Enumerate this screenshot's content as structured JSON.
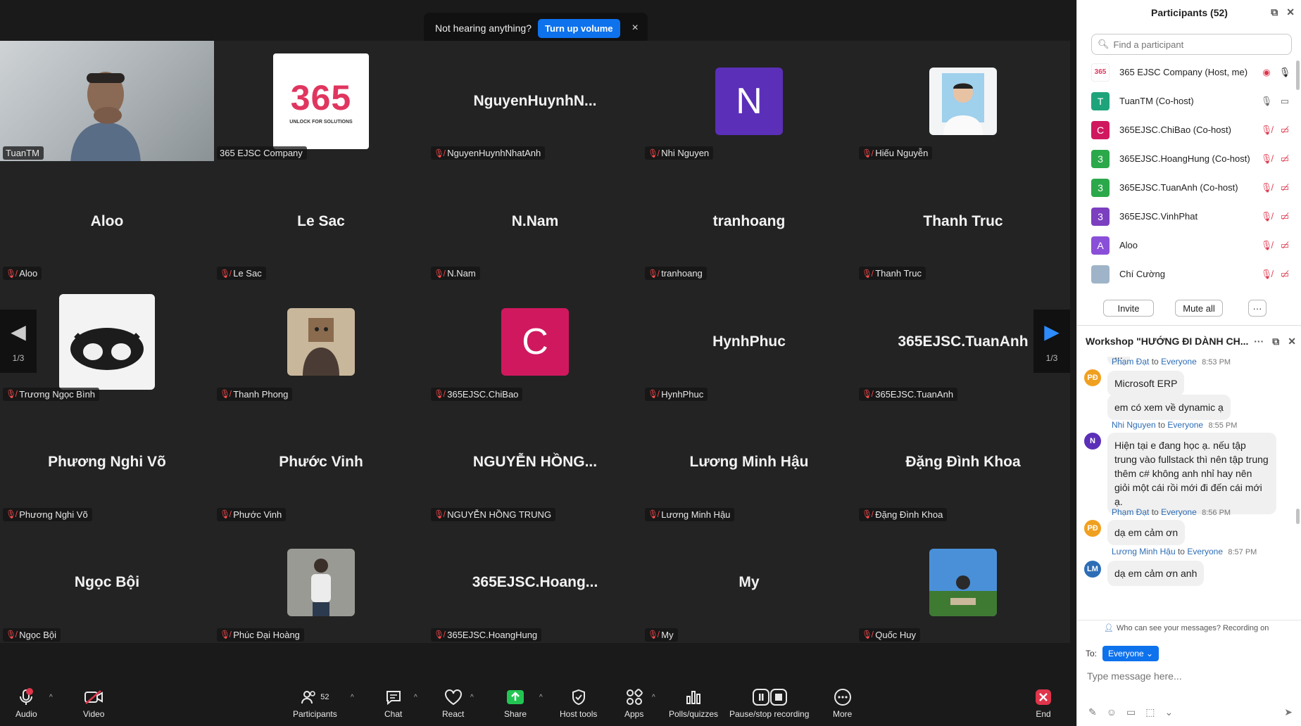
{
  "banner": {
    "text": "Not hearing anything?",
    "button": "Turn up volume",
    "close": "×"
  },
  "pager": {
    "left": "1/3",
    "right": "1/3"
  },
  "tiles": [
    {
      "label": "TuanTM",
      "kind": "video"
    },
    {
      "label": "365 EJSC Company",
      "kind": "logo"
    },
    {
      "center": "NguyenHuynhN...",
      "label": "NguyenHuynhNhatAnh",
      "kind": "name"
    },
    {
      "avatar": "N",
      "avatar_color": "#5b2fb8",
      "label": "Nhi Nguyen",
      "kind": "avatar"
    },
    {
      "label": "Hiếu Nguyễn",
      "kind": "photo-portrait"
    },
    {
      "center": "Aloo",
      "label": "Aloo",
      "kind": "name"
    },
    {
      "center": "Le Sac",
      "label": "Le Sac",
      "kind": "name"
    },
    {
      "center": "N.Nam",
      "label": "N.Nam",
      "kind": "name"
    },
    {
      "center": "tranhoang",
      "label": "tranhoang",
      "kind": "name"
    },
    {
      "center": "Thanh Truc",
      "label": "Thanh Truc",
      "kind": "name"
    },
    {
      "label": "Trương Ngọc Bình",
      "kind": "photo-cat"
    },
    {
      "label": "Thanh Phong",
      "kind": "photo-cartoon"
    },
    {
      "avatar": "C",
      "avatar_color": "#d0185f",
      "label": "365EJSC.ChiBao",
      "kind": "avatar"
    },
    {
      "center": "HynhPhuc",
      "label": "HynhPhuc",
      "kind": "name"
    },
    {
      "center": "365EJSC.TuanAnh",
      "label": "365EJSC.TuanAnh",
      "kind": "name"
    },
    {
      "center": "Phương Nghi Võ",
      "label": "Phương Nghi Võ",
      "kind": "name"
    },
    {
      "center": "Phước Vinh",
      "label": "Phước Vinh",
      "kind": "name"
    },
    {
      "center": "NGUYỄN  HỒNG...",
      "label": "NGUYỄN HỒNG TRUNG",
      "kind": "name"
    },
    {
      "center": "Lương Minh Hậu",
      "label": "Lương Minh Hậu",
      "kind": "name"
    },
    {
      "center": "Đặng Đình Khoa",
      "label": "Đặng Đình Khoa",
      "kind": "name"
    },
    {
      "center": "Ngọc Bội",
      "label": "Ngọc Bội",
      "kind": "name"
    },
    {
      "label": "Phúc Đại Hoàng",
      "kind": "photo-person"
    },
    {
      "center": "365EJSC.Hoang...",
      "label": "365EJSC.HoangHung",
      "kind": "name"
    },
    {
      "center": "My",
      "label": "My",
      "kind": "name"
    },
    {
      "label": "Quốc Huy",
      "kind": "photo-outdoor"
    }
  ],
  "logo365": {
    "num": "365",
    "tag": "UNLOCK FOR SOLUTIONS"
  },
  "toolbar": {
    "audio": "Audio",
    "video": "Video",
    "participants": "Participants",
    "participants_count": "52",
    "chat": "Chat",
    "react": "React",
    "share": "Share",
    "host_tools": "Host tools",
    "apps": "Apps",
    "polls": "Polls/quizzes",
    "recording": "Pause/stop recording",
    "more": "More",
    "end": "End"
  },
  "participants_panel": {
    "title": "Participants (52)",
    "search_placeholder": "Find a participant",
    "invite": "Invite",
    "mute_all": "Mute all",
    "more": "···",
    "rows": [
      {
        "name": "365 EJSC Company (Host, me)",
        "avatar": "365",
        "color": "#ffffff"
      },
      {
        "name": "TuanTM (Co-host)",
        "avatar": "T",
        "color": "#1fa37a"
      },
      {
        "name": "365EJSC.ChiBao (Co-host)",
        "avatar": "C",
        "color": "#d0185f"
      },
      {
        "name": "365EJSC.HoangHung (Co-host)",
        "avatar": "3",
        "color": "#2ba84a"
      },
      {
        "name": "365EJSC.TuanAnh (Co-host)",
        "avatar": "3",
        "color": "#2ba84a"
      },
      {
        "name": "365EJSC.VinhPhat",
        "avatar": "3",
        "color": "#7b3fbf"
      },
      {
        "name": "Aloo",
        "avatar": "A",
        "color": "#8a4fd8"
      },
      {
        "name": "Chí Cường",
        "avatar": "",
        "color": "#9fb4c8"
      }
    ]
  },
  "chat_panel": {
    "title": "Workshop \"HƯỚNG ĐI DÀNH CH...",
    "partial_top": "...",
    "messages": [
      {
        "sender": "Phạm Đạt",
        "to": "to",
        "target": "Everyone",
        "time": "8:53 PM",
        "avatar": "PĐ",
        "color": "#f0a020",
        "lines": [
          "Microsoft ERP",
          "em có xem về dynamic ạ"
        ]
      },
      {
        "sender": "Nhi Nguyen",
        "to": "to",
        "target": "Everyone",
        "time": "8:55 PM",
        "avatar": "N",
        "color": "#5b2fb8",
        "lines": [
          "Hiện tại e đang học ạ. nếu tập trung vào fullstack thì nên tập trung thêm c# không anh nhỉ hay nên giỏi một cái rồi mới đi đến cái mới ạ."
        ]
      },
      {
        "sender": "Phạm Đạt",
        "to": "to",
        "target": "Everyone",
        "time": "8:56 PM",
        "avatar": "PĐ",
        "color": "#f0a020",
        "lines": [
          "dạ em cảm ơn"
        ]
      },
      {
        "sender": "Lương Minh Hậu",
        "to": "to",
        "target": "Everyone",
        "time": "8:57 PM",
        "avatar": "LM",
        "color": "#2d6db5",
        "lines": [
          "dạ em cảm ơn anh"
        ]
      }
    ],
    "visibility": "Who can see your messages? Recording on",
    "to_label": "To:",
    "to_value": "Everyone ⌄",
    "input_placeholder": "Type message here..."
  }
}
